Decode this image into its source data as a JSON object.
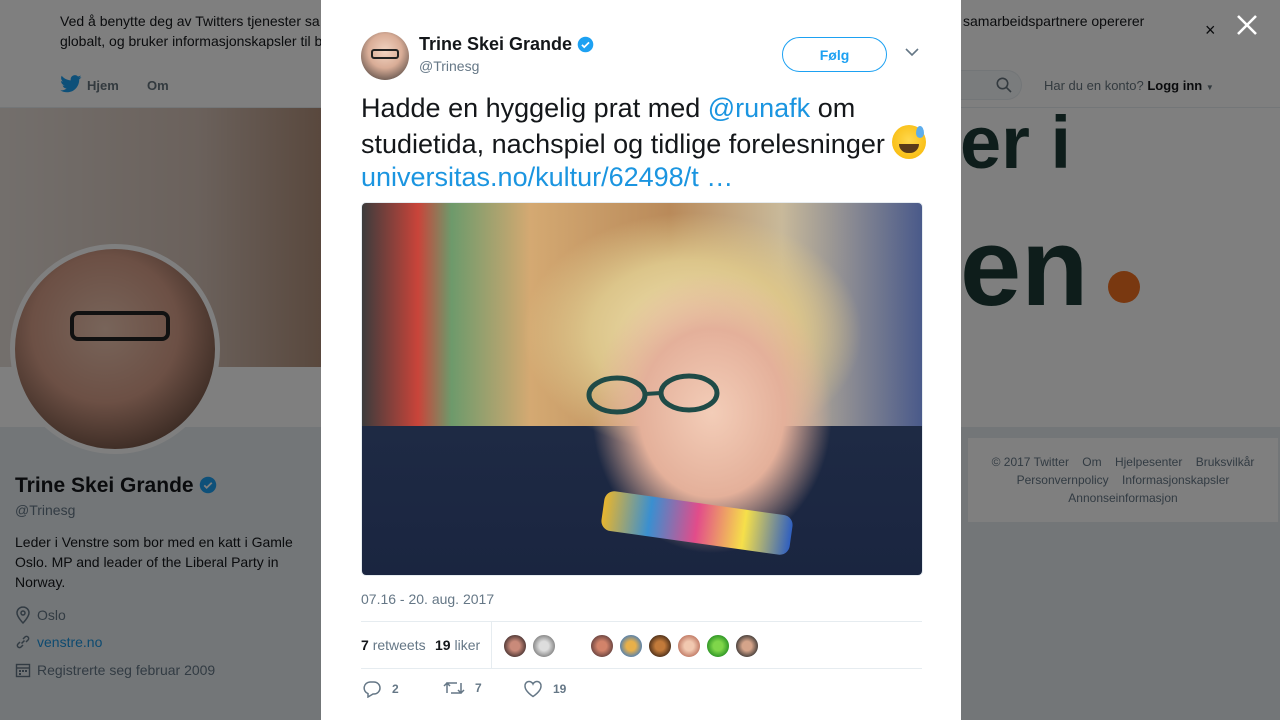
{
  "cookie_bar": {
    "text_start": "Ved å benytte deg av Twitters tjenester sa",
    "text_end": "samarbeidspartnere opererer",
    "text_line2": "globalt, og bruker informasjonskapsler til b",
    "close_glyph": "×"
  },
  "nav": {
    "home": "Hjem",
    "about": "Om",
    "account_prompt": "Har du en konto?",
    "login": "Logg inn"
  },
  "banner": {
    "word1": "er i",
    "word2": "en",
    "dot_color": "#f37021"
  },
  "profile": {
    "name": "Trine Skei Grande",
    "handle": "@Trinesg",
    "bio": "Leder i Venstre som bor med en katt i Gamle Oslo. MP and leader of the Liberal Party in Norway.",
    "location": "Oslo",
    "website": "venstre.no",
    "joined": "Registrerte seg februar 2009"
  },
  "footer": {
    "links_row1": [
      "© 2017 Twitter",
      "Om",
      "Hjelpesenter",
      "Bruksvilkår"
    ],
    "links_row2": [
      "Personvernpolicy",
      "Informasjonskapsler"
    ],
    "links_row3": [
      "Annonseinformasjon"
    ]
  },
  "tweet": {
    "author_name": "Trine Skei Grande",
    "author_handle": "@Trinesg",
    "follow_label": "Følg",
    "text_prefix": "Hadde en hyggelig prat med ",
    "mention": "@runafk",
    "text_middle": " om studietida, nachspiel og tidlige forelesninger ",
    "link": "universitas.no/kultur/62498/t",
    "link_ellipsis": " …",
    "timestamp": "07.16 - 20. aug. 2017",
    "retweets_count": "7",
    "retweets_label": "retweets",
    "likes_count": "19",
    "likes_label": "liker",
    "reply_count": "2",
    "retweet_count": "7",
    "like_count": "19"
  },
  "colors": {
    "accent": "#1da1f2",
    "link": "#1b95e0",
    "verified": "#1da1f2"
  },
  "icons": {
    "verified": "verified-badge-icon",
    "reply": "reply-icon",
    "retweet": "retweet-icon",
    "like": "heart-icon",
    "location": "location-pin-icon",
    "link": "link-icon",
    "calendar": "calendar-icon",
    "close": "close-icon",
    "caret": "chevron-down-icon"
  }
}
